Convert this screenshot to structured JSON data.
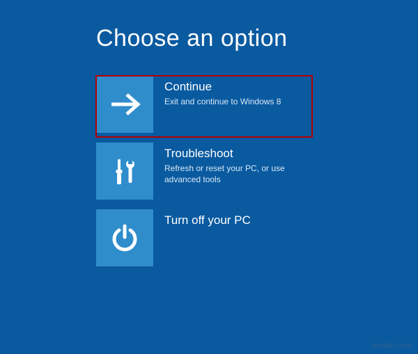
{
  "colors": {
    "background": "#0a5aa0",
    "tile": "#2f8dcc",
    "highlight": "#b30000",
    "text": "#ffffff",
    "subtext": "#d7e9f7"
  },
  "title": "Choose an option",
  "options": [
    {
      "icon": "arrow-right-icon",
      "title": "Continue",
      "description": "Exit and continue to Windows 8",
      "highlighted": true
    },
    {
      "icon": "tools-icon",
      "title": "Troubleshoot",
      "description": "Refresh or reset your PC, or use advanced tools",
      "highlighted": false
    },
    {
      "icon": "power-icon",
      "title": "Turn off your PC",
      "description": "",
      "highlighted": false
    }
  ],
  "watermark": "wsxdn.com"
}
